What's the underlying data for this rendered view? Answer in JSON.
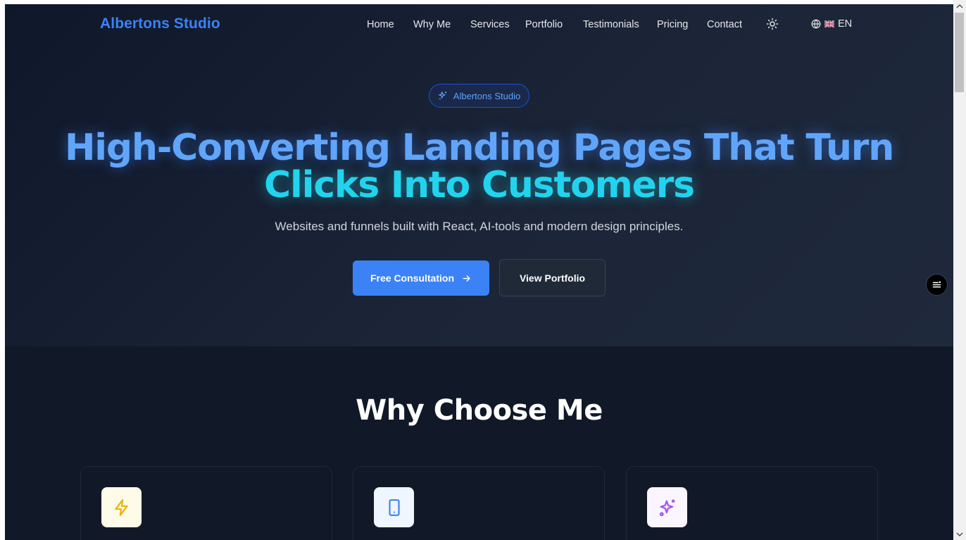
{
  "nav": {
    "logo": "Albertons Studio",
    "links": [
      "Home",
      "Why Me",
      "Services",
      "Portfolio",
      "Testimonials",
      "Pricing",
      "Contact"
    ],
    "language": "EN",
    "theme_icon": "sun-icon",
    "language_icon": "globe-icon"
  },
  "hero": {
    "badge": "Albertons Studio",
    "headline_line1": "High-Converting Landing Pages That Turn",
    "headline_line2": "Clicks Into Customers",
    "subtitle": "Websites and funnels built with React, AI-tools and modern design principles.",
    "cta_primary": "Free Consultation",
    "cta_secondary": "View Portfolio"
  },
  "why": {
    "title": "Why Choose Me",
    "cards": [
      {
        "icon": "lightning-icon",
        "icon_color": "#eab308",
        "bg": "#fefce8"
      },
      {
        "icon": "tablet-icon",
        "icon_color": "#3b82f6",
        "bg": "#eff6ff"
      },
      {
        "icon": "sparkles-icon",
        "icon_color": "#a855f7",
        "bg": "#faf5ff"
      }
    ]
  },
  "colors": {
    "accent": "#3b82f6",
    "cyan": "#22d3ee",
    "background": "#111827"
  }
}
